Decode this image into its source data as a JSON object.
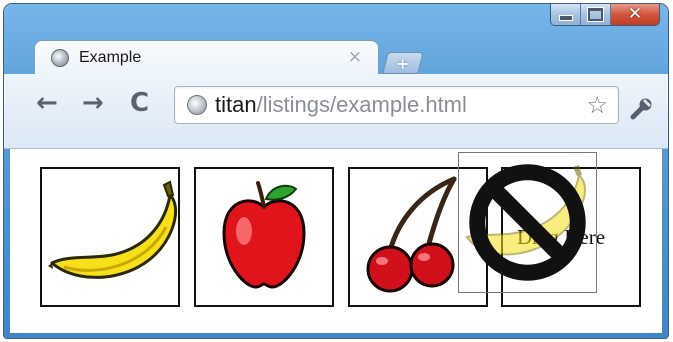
{
  "window": {
    "controls": {
      "minimize": "minimize",
      "maximize": "maximize",
      "close": "✕"
    }
  },
  "tab": {
    "title": "Example",
    "close_glyph": "×",
    "favicon": "globe-icon"
  },
  "new_tab": {
    "glyph": "+"
  },
  "toolbar": {
    "back_glyph": "←",
    "forward_glyph": "→",
    "reload_glyph": "C",
    "url_host": "titan",
    "url_path": "/listings/example.html",
    "star_glyph": "☆",
    "wrench_icon": "wrench-icon"
  },
  "page": {
    "fruits": [
      {
        "name": "banana",
        "icon": "banana-icon"
      },
      {
        "name": "apple",
        "icon": "apple-icon"
      },
      {
        "name": "cherries",
        "icon": "cherries-icon"
      }
    ],
    "drop_target": {
      "label": "Drag Here"
    },
    "drag_ghost": {
      "icon": "banana-icon",
      "cursor": "no-drop-icon"
    }
  },
  "colors": {
    "frame": "#5a9ed8",
    "banana": "#f7e01a",
    "apple": "#e0141b",
    "cherry": "#d0101a"
  }
}
